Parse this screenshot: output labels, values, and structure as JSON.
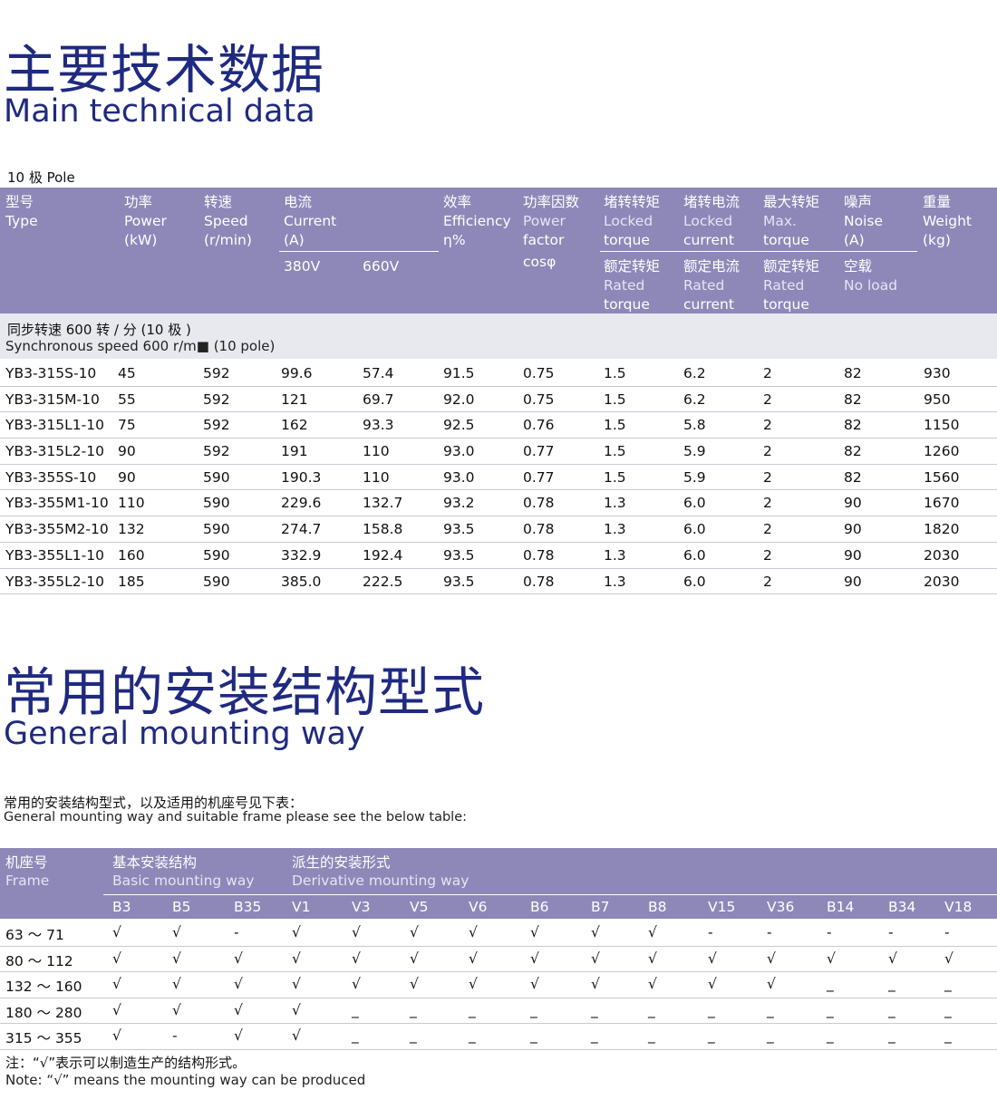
{
  "section1": {
    "title_cn": "主要技术数据",
    "title_en": "Main technical data",
    "pole_label": "10 极 Pole",
    "headers": {
      "type": [
        "型号",
        "Type"
      ],
      "power": [
        "功率",
        "Power",
        "(kW)"
      ],
      "speed": [
        "转速",
        "Speed",
        "(r/min)"
      ],
      "current": [
        "电流",
        "Current",
        "(A)"
      ],
      "v380": "380V",
      "v660": "660V",
      "efficiency": [
        "效率",
        "Efficiency",
        "η%"
      ],
      "pf": [
        "功率因数",
        "Power",
        "factor",
        "cosφ"
      ],
      "locked_torque": [
        "堵转转矩",
        "Locked",
        "torque"
      ],
      "locked_current": [
        "堵转电流",
        "Locked",
        "current"
      ],
      "max_torque": [
        "最大转矩",
        "Max.",
        "torque"
      ],
      "noise": [
        "噪声",
        "Noise",
        "(A)"
      ],
      "weight": [
        "重量",
        "Weight",
        "(kg)"
      ],
      "rated_torque": [
        "额定转矩",
        "Rated",
        "torque"
      ],
      "rated_current": [
        "额定电流",
        "Rated",
        "current"
      ],
      "rated_torque2": [
        "额定转矩",
        "Rated",
        "torque"
      ],
      "no_load": [
        "空载",
        "No load"
      ]
    },
    "sync_cn": "同步转速 600 转 / 分 (10 极 )",
    "sync_en": "Synchronous speed 600 r/m■ (10 pole)",
    "rows": [
      [
        "YB3-315S-10",
        "45",
        "592",
        "99.6",
        "57.4",
        "91.5",
        "0.75",
        "1.5",
        "6.2",
        "2",
        "82",
        "930"
      ],
      [
        "YB3-315M-10",
        "55",
        "592",
        "121",
        "69.7",
        "92.0",
        "0.75",
        "1.5",
        "6.2",
        "2",
        "82",
        "950"
      ],
      [
        "YB3-315L1-10",
        "75",
        "592",
        "162",
        "93.3",
        "92.5",
        "0.76",
        "1.5",
        "5.8",
        "2",
        "82",
        "1150"
      ],
      [
        "YB3-315L2-10",
        "90",
        "592",
        "191",
        "110",
        "93.0",
        "0.77",
        "1.5",
        "5.9",
        "2",
        "82",
        "1260"
      ],
      [
        "YB3-355S-10",
        "90",
        "590",
        "190.3",
        "110",
        "93.0",
        "0.77",
        "1.5",
        "5.9",
        "2",
        "82",
        "1560"
      ],
      [
        "YB3-355M1-10",
        "110",
        "590",
        "229.6",
        "132.7",
        "93.2",
        "0.78",
        "1.3",
        "6.0",
        "2",
        "90",
        "1670"
      ],
      [
        "YB3-355M2-10",
        "132",
        "590",
        "274.7",
        "158.8",
        "93.5",
        "0.78",
        "1.3",
        "6.0",
        "2",
        "90",
        "1820"
      ],
      [
        "YB3-355L1-10",
        "160",
        "590",
        "332.9",
        "192.4",
        "93.5",
        "0.78",
        "1.3",
        "6.0",
        "2",
        "90",
        "2030"
      ],
      [
        "YB3-355L2-10",
        "185",
        "590",
        "385.0",
        "222.5",
        "93.5",
        "0.78",
        "1.3",
        "6.0",
        "2",
        "90",
        "2030"
      ]
    ]
  },
  "section2": {
    "title_cn": "常用的安装结构型式",
    "title_en": "General mounting way",
    "intro_cn": "常用的安装结构型式，以及适用的机座号见下表：",
    "intro_en": "General mounting way and suitable frame please see the below table:",
    "headers": {
      "frame": [
        "机座号",
        "Frame"
      ],
      "basic": [
        "基本安装结构",
        "Basic mounting way"
      ],
      "derivative": [
        "派生的安装形式",
        "Derivative mounting way"
      ]
    },
    "sub_headers": [
      "B3",
      "B5",
      "B35",
      "V1",
      "V3",
      "V5",
      "V6",
      "B6",
      "B7",
      "B8",
      "V15",
      "V36",
      "B14",
      "B34",
      "V18"
    ],
    "rows": [
      [
        "63 ～ 71",
        "√",
        "√",
        "-",
        "√",
        "√",
        "√",
        "√",
        "√",
        "√",
        "√",
        "-",
        "-",
        "-",
        "-",
        "-"
      ],
      [
        "80 ～ 112",
        "√",
        "√",
        "√",
        "√",
        "√",
        "√",
        "√",
        "√",
        "√",
        "√",
        "√",
        "√",
        "√",
        "√",
        "√"
      ],
      [
        "132 ～ 160",
        "√",
        "√",
        "√",
        "√",
        "√",
        "√",
        "√",
        "√",
        "√",
        "√",
        "√",
        "√",
        "_",
        "_",
        "_"
      ],
      [
        "180 ～ 280",
        "√",
        "√",
        "√",
        "√",
        "_",
        "_",
        "_",
        "_",
        "_",
        "_",
        "_",
        "_",
        "_",
        "_",
        "_"
      ],
      [
        "315 ～ 355",
        "√",
        "-",
        "√",
        "√",
        "_",
        "_",
        "_",
        "_",
        "_",
        "_",
        "_",
        "_",
        "_",
        "_",
        "_"
      ]
    ],
    "note_cn": "注：“√”表示可以制造生产的结构形式。",
    "note_en": "Note: “√” means the mounting way can be produced"
  }
}
